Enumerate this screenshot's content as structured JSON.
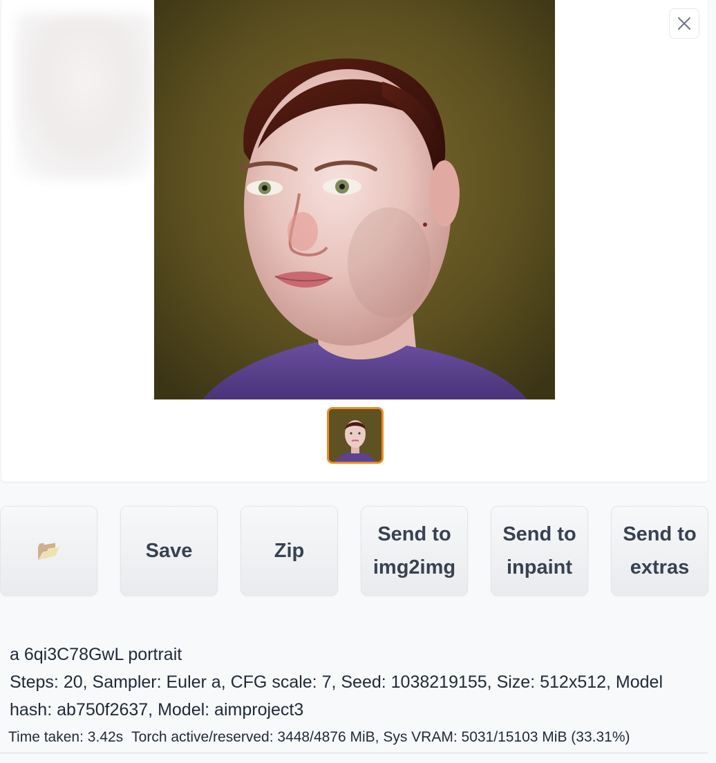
{
  "gallery": {
    "close_icon": "close-icon",
    "thumbnail_selected": true
  },
  "actions": {
    "folder_icon": "folder-icon",
    "folder_glyph": "📂",
    "save_label": "Save",
    "zip_label": "Zip",
    "send_img2img_line1": "Send to",
    "send_img2img_line2": "img2img",
    "send_inpaint_line1": "Send to",
    "send_inpaint_line2": "inpaint",
    "send_extras_line1": "Send to",
    "send_extras_line2": "extras"
  },
  "generation_info": {
    "prompt": "a 6qi3C78GwL portrait",
    "params": "Steps: 20, Sampler: Euler a, CFG scale: 7, Seed: 1038219155, Size: 512x512, Model hash: ab750f2637, Model: aimproject3"
  },
  "performance": {
    "time_taken": "Time taken: 3.42s",
    "memory": "Torch active/reserved: 3448/4876 MiB, Sys VRAM: 5031/15103 MiB (33.31%)"
  },
  "colors": {
    "thumb_selected_border": "#f08a24",
    "button_text": "#374151"
  }
}
